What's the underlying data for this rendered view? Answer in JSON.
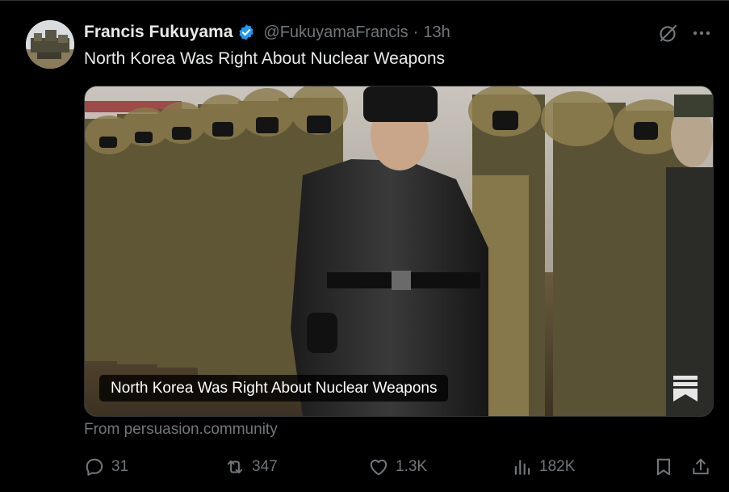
{
  "tweet": {
    "author_name": "Francis Fukuyama",
    "verified": true,
    "handle": "@FukuyamaFrancis",
    "separator": "·",
    "time": "13h",
    "text": "North Korea Was Right About Nuclear Weapons"
  },
  "card": {
    "title": "North Korea Was Right About Nuclear Weapons",
    "source": "From persuasion.community"
  },
  "actions": {
    "replies": "31",
    "reposts": "347",
    "likes": "1.3K",
    "views": "182K"
  },
  "icons": {
    "verified": "verified-badge-icon",
    "grok": "grok-icon",
    "more": "more-options-icon",
    "reply": "reply-icon",
    "repost": "repost-icon",
    "like": "heart-icon",
    "views": "views-icon",
    "bookmark": "bookmark-icon",
    "share": "share-icon"
  },
  "colors": {
    "background": "#000000",
    "text": "#e7e9ea",
    "muted": "#71767b",
    "verified": "#1d9bf0",
    "border": "#2f3336"
  }
}
